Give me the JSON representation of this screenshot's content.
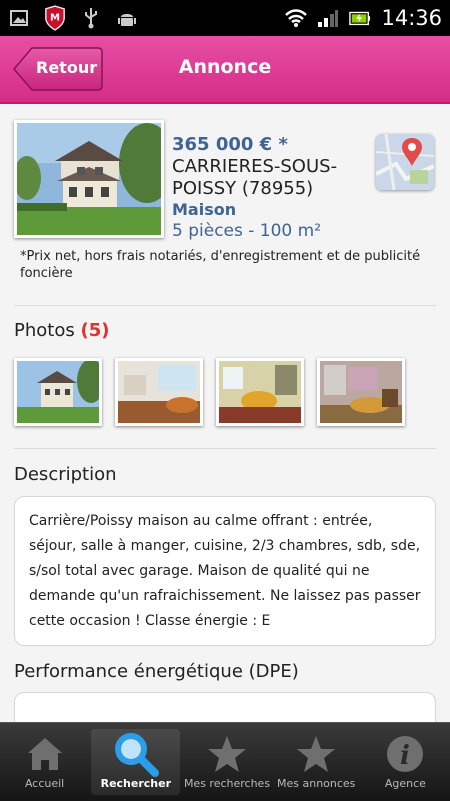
{
  "status_bar": {
    "time": "14:36",
    "icons": [
      "gallery-icon",
      "mcafee-icon",
      "usb-icon",
      "android-icon",
      "wifi-icon",
      "signal-icon",
      "battery-icon"
    ]
  },
  "header": {
    "back_label": "Retour",
    "title": "Annonce"
  },
  "listing": {
    "price": "365 000 € *",
    "city": "CARRIERES-SOUS-POISSY (78955)",
    "type": "Maison",
    "rooms": "5 pièces - 100 m²",
    "price_note": "*Prix net, hors frais notariés, d'enregistrement et de publicité foncière"
  },
  "photos": {
    "title": "Photos",
    "count": "(5)"
  },
  "description": {
    "title": "Description",
    "text": "Carrière/Poissy maison au calme offrant : entrée, séjour, salle à manger, cuisine, 2/3 chambres, sdb, sde, s/sol total avec garage. Maison de qualité qui ne demande qu'un rafraichissement. Ne laissez pas passer cette occasion ! Classe énergie : E"
  },
  "dpe": {
    "title": "Performance énergétique (DPE)"
  },
  "tabs": [
    {
      "label": "Accueil",
      "icon": "home-icon"
    },
    {
      "label": "Rechercher",
      "icon": "search-icon"
    },
    {
      "label": "Mes recherches",
      "icon": "star-icon"
    },
    {
      "label": "Mes annonces",
      "icon": "star-icon"
    },
    {
      "label": "Agence",
      "icon": "info-icon"
    }
  ],
  "colors": {
    "accent": "#d9348f",
    "link_blue": "#3f6494",
    "count_red": "#e03030"
  }
}
